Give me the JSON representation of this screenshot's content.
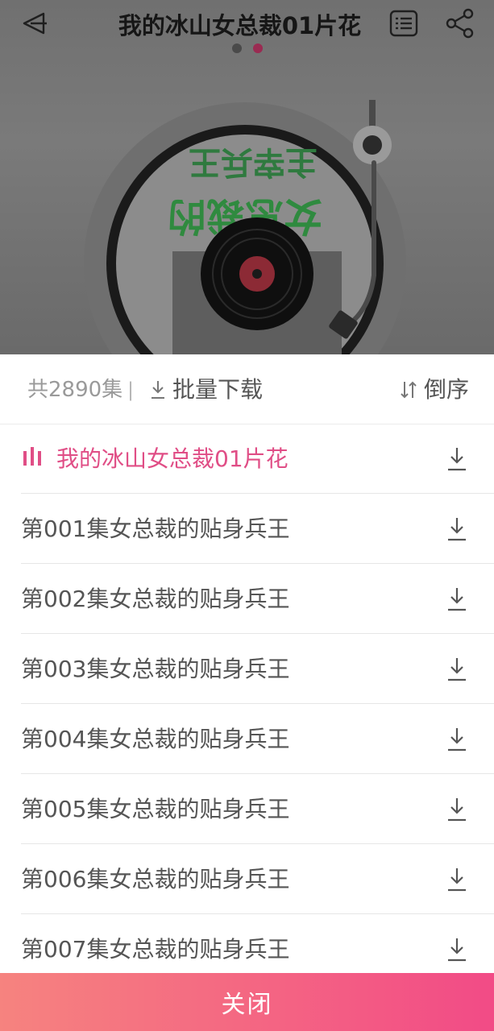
{
  "header": {
    "title": "我的冰山女总裁01片花"
  },
  "cover": {
    "art_text_top": "主宰兵王",
    "art_text_mid": "女总裁的"
  },
  "playlist": {
    "count_label": "共2890集",
    "separator": "|",
    "batch_download_label": "批量下载",
    "sort_label": "倒序",
    "items": [
      {
        "title": "我的冰山女总裁01片花",
        "active": true
      },
      {
        "title": "第001集女总裁的贴身兵王"
      },
      {
        "title": "第002集女总裁的贴身兵王"
      },
      {
        "title": "第003集女总裁的贴身兵王"
      },
      {
        "title": "第004集女总裁的贴身兵王"
      },
      {
        "title": "第005集女总裁的贴身兵王"
      },
      {
        "title": "第006集女总裁的贴身兵王"
      },
      {
        "title": "第007集女总裁的贴身兵王"
      }
    ]
  },
  "footer": {
    "close_label": "关闭"
  },
  "colors": {
    "accent": "#e04e86",
    "close_gradient_start": "#f6837f",
    "close_gradient_end": "#f24b86",
    "dim_overlay": "#6e6e6e"
  },
  "icons": {
    "back": "back-arrow-icon",
    "playlist": "playlist-icon",
    "share": "share-icon",
    "download": "download-icon",
    "sort": "sort-icon",
    "playing": "playing-bars-icon"
  }
}
